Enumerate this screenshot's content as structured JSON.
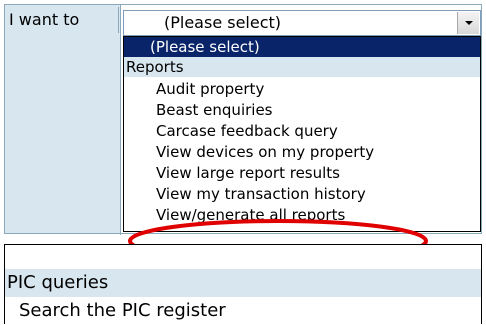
{
  "form": {
    "label": "I want to"
  },
  "select": {
    "value": "(Please select)"
  },
  "dropdown": {
    "selected": "(Please select)",
    "groups": [
      {
        "label": "Reports",
        "items": [
          "Audit property",
          "Beast enquiries",
          "Carcase feedback query",
          "View devices on my property",
          "View large report results",
          "View my transaction history",
          "View/generate all reports"
        ]
      }
    ]
  },
  "second_panel": {
    "group_label": "PIC queries",
    "item": "Search the PIC register"
  },
  "colors": {
    "group_bg": "#d7e6ef",
    "selected_bg": "#0a246a",
    "highlight": "#e00000"
  }
}
